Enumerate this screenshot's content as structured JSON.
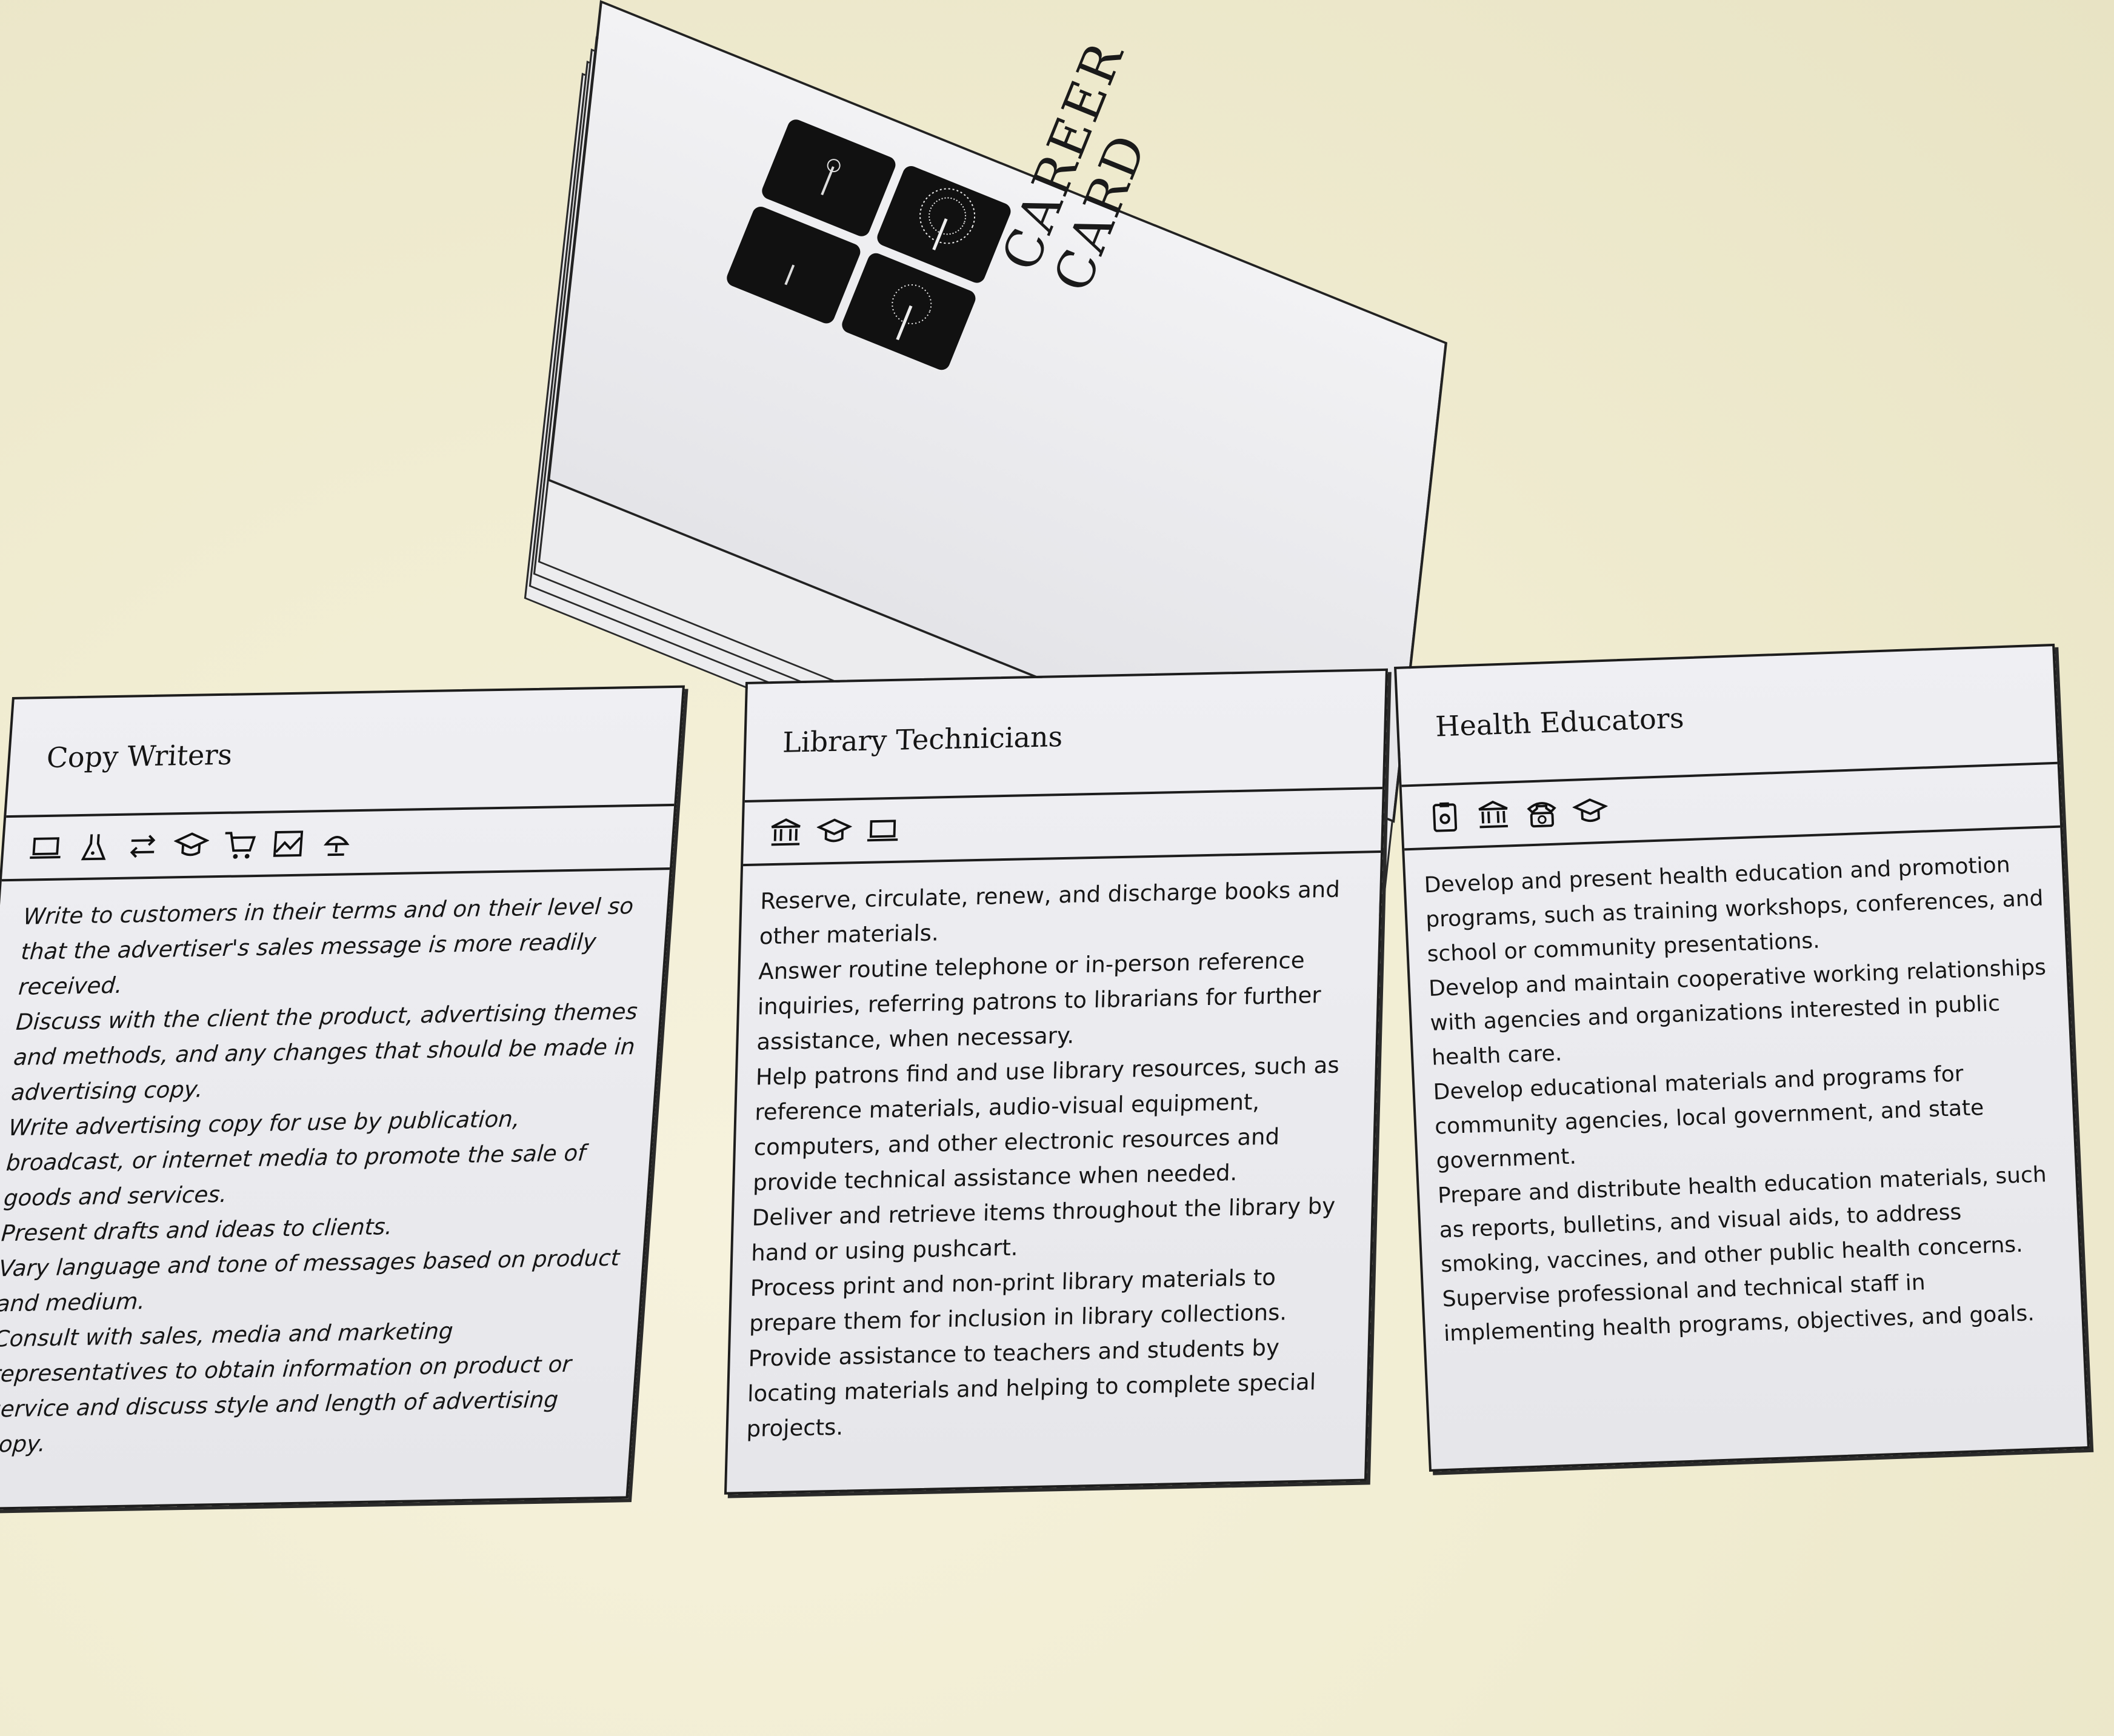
{
  "stack": {
    "brand_line1": "CAREER",
    "brand_line2": "CARD",
    "logo_icon": "tree-seasons-logo-icon"
  },
  "cards": [
    {
      "title": "Copy Writers",
      "icons": [
        "laptop-icon",
        "flask-icon",
        "arrows-exchange-icon",
        "graduation-cap-icon",
        "shopping-cart-icon",
        "chart-image-icon",
        "desk-lamp-icon"
      ],
      "tasks": [
        "Write to customers in their terms and on their level so that the advertiser's sales message is more readily received.",
        "Discuss with the client the product, advertising themes and methods, and any changes that should be made in advertising copy.",
        "Write advertising copy for use by publication, broadcast, or internet media to promote the sale of goods and services.",
        "Present drafts and ideas to clients.",
        "Vary language and tone of messages based on product and medium.",
        "Consult with sales, media and marketing representatives to obtain information on product or service and discuss style and length of advertising copy."
      ]
    },
    {
      "title": "Library Technicians",
      "icons": [
        "bank-building-icon",
        "graduation-cap-icon",
        "laptop-icon"
      ],
      "tasks": [
        "Reserve, circulate, renew, and discharge books and other materials.",
        "Answer routine telephone or in-person reference inquiries, referring patrons to librarians for further assistance, when necessary.",
        "Help patrons find and use library resources, such as reference materials, audio-visual equipment, computers, and other electronic resources and provide technical assistance when needed.",
        "Deliver and retrieve items throughout the library by hand or using pushcart.",
        "Process print and non-print library materials to prepare them for inclusion in library collections.",
        "Provide assistance to teachers and students by locating materials and helping to complete special projects."
      ]
    },
    {
      "title": "Health Educators",
      "icons": [
        "clipboard-heart-icon",
        "bank-building-icon",
        "telephone-icon",
        "graduation-cap-icon"
      ],
      "tasks": [
        "Develop and present health education and promotion programs, such as training workshops, conferences, and school or community presentations.",
        "Develop and maintain cooperative working relationships with agencies and organizations interested in public health care.",
        "Develop educational materials and programs for community agencies, local government, and state government.",
        "Prepare and distribute health education materials, such as reports, bulletins, and visual aids, to address smoking, vaccines, and other public health concerns.",
        "Supervise professional and technical staff in implementing health programs, objectives, and goals."
      ]
    }
  ]
}
